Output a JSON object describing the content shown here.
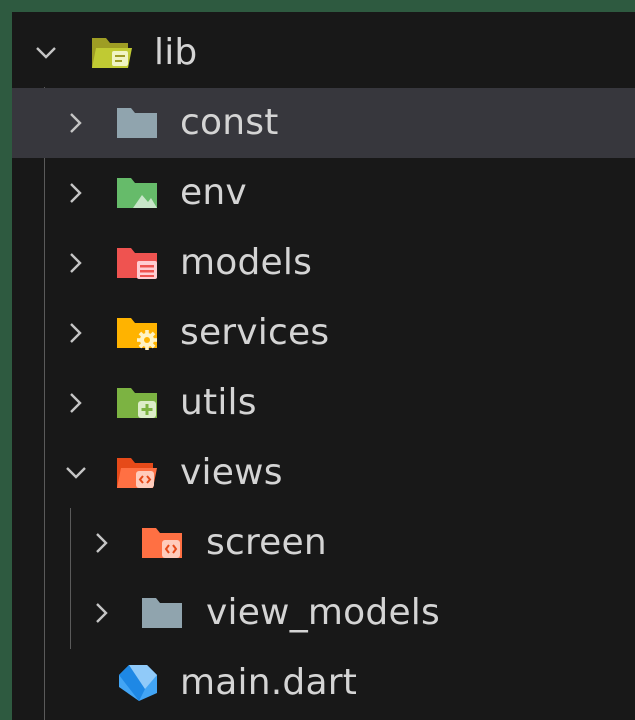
{
  "explorer": {
    "items": [
      {
        "label": "lib",
        "expanded": true,
        "icon": "folder-lib-open-icon",
        "color": "#c0ca33"
      },
      {
        "label": "const",
        "expanded": false,
        "icon": "folder-icon",
        "color": "#90a4ae"
      },
      {
        "label": "env",
        "expanded": false,
        "icon": "folder-environment-icon",
        "color": "#66bb6a"
      },
      {
        "label": "models",
        "expanded": false,
        "icon": "folder-models-icon",
        "color": "#ef5350"
      },
      {
        "label": "services",
        "expanded": false,
        "icon": "folder-services-icon",
        "color": "#ffca28"
      },
      {
        "label": "utils",
        "expanded": false,
        "icon": "folder-utils-icon",
        "color": "#7cb342"
      },
      {
        "label": "views",
        "expanded": true,
        "icon": "folder-views-open-icon",
        "color": "#ff7043"
      },
      {
        "label": "screen",
        "expanded": false,
        "icon": "folder-views-icon",
        "color": "#ff7043"
      },
      {
        "label": "view_models",
        "expanded": false,
        "icon": "folder-icon",
        "color": "#90a4ae"
      },
      {
        "label": "main.dart",
        "icon": "dart-file-icon",
        "color": "#42a5f5"
      }
    ]
  }
}
